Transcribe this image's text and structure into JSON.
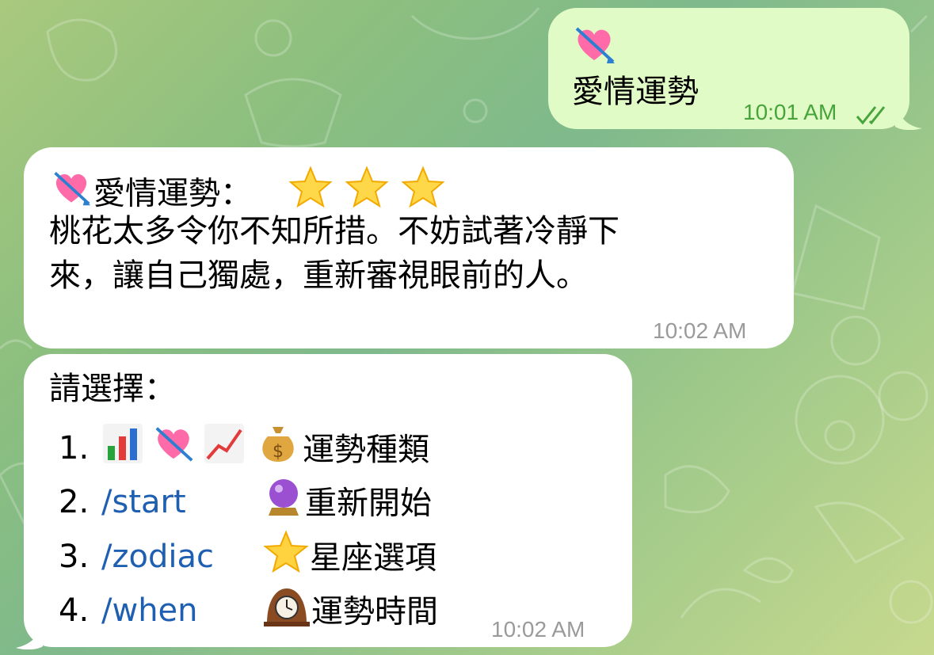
{
  "outgoing": {
    "text": "愛情運勢",
    "time": "10:01 AM",
    "emoji_icon": "heart-with-arrow-icon",
    "status_icon": "double-check-icon"
  },
  "incoming1": {
    "title": "愛情運勢：",
    "title_icon": "heart-with-arrow-icon",
    "rating_icons": [
      "glowing-star-icon",
      "glowing-star-icon",
      "glowing-star-icon"
    ],
    "line1": "桃花太多令你不知所措。不妨試著冷靜下",
    "line2": "來，讓自己獨處，重新審視眼前的人。",
    "time": "10:02 AM"
  },
  "incoming2": {
    "heading": "請選擇：",
    "items": [
      {
        "num": "1.",
        "icons": [
          "bar-chart-icon",
          "heart-with-arrow-icon",
          "chart-increasing-icon",
          "money-bag-icon"
        ],
        "label": "運勢種類"
      },
      {
        "num": "2.",
        "command": "/start",
        "icon": "crystal-ball-icon",
        "label": "重新開始"
      },
      {
        "num": "3.",
        "command": "/zodiac",
        "icon": "star-icon",
        "label": "星座選項"
      },
      {
        "num": "4.",
        "command": "/when",
        "icon": "mantelpiece-clock-icon",
        "label": "運勢時間"
      }
    ],
    "time": "10:02 AM"
  },
  "colors": {
    "outgoing_bubble": "#e1fbc6",
    "incoming_bubble": "#ffffff",
    "link": "#1f5fb2",
    "outgoing_time": "#47a43b",
    "incoming_time": "#9a9a9a"
  }
}
